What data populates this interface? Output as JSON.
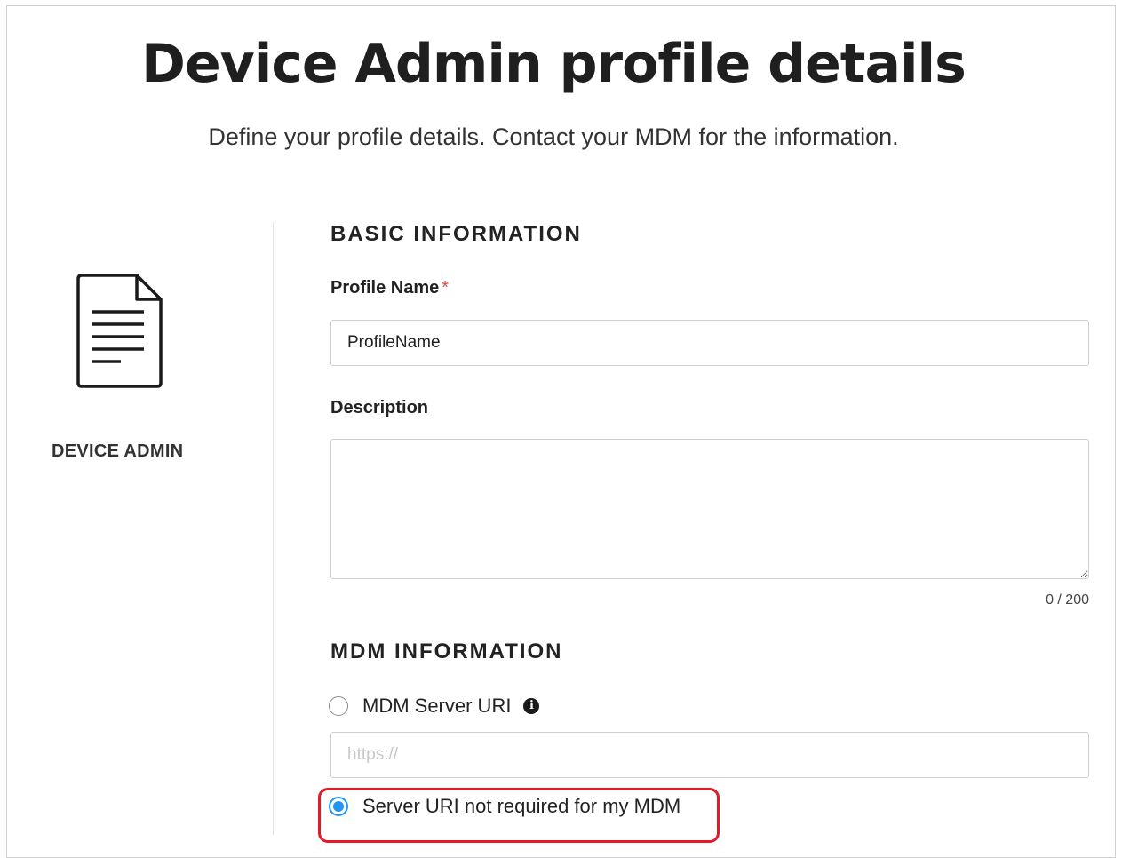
{
  "header": {
    "title": "Device Admin profile details",
    "subtitle": "Define your profile details. Contact your MDM for the information."
  },
  "left_panel": {
    "icon": "document-icon",
    "label": "DEVICE ADMIN"
  },
  "basic_information": {
    "section_title": "BASIC INFORMATION",
    "profile_name_label": "Profile Name",
    "required_marker": "*",
    "profile_name_value": "ProfileName",
    "description_label": "Description",
    "description_value": "",
    "description_counter": "0 / 200"
  },
  "mdm_information": {
    "section_title": "MDM INFORMATION",
    "server_uri_option_label": "MDM Server URI",
    "server_uri_placeholder": "https://",
    "server_uri_option_selected": false,
    "not_required_option_label": "Server URI not required for my MDM",
    "not_required_option_selected": true,
    "info_icon": "info-icon"
  },
  "colors": {
    "radio_selected": "#2196f3",
    "highlight_annotation": "#e21b2b",
    "required_marker": "#e5473f"
  }
}
